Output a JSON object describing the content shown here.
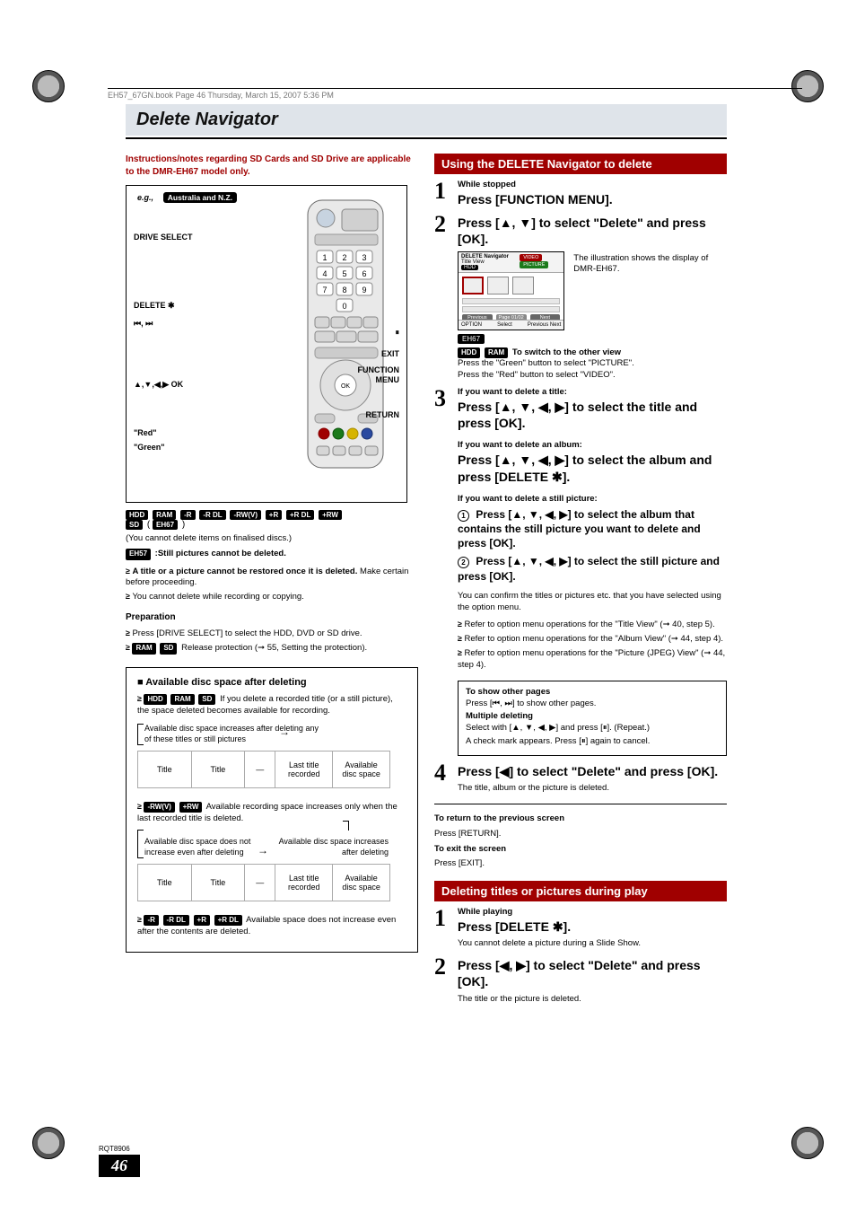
{
  "top_rule_text": "EH57_67GN.book  Page 46  Thursday, March 15, 2007  5:36 PM",
  "page_title": "Delete Navigator",
  "sd_note": "Instructions/notes regarding SD Cards and SD Drive are applicable to the DMR-EH67 model only.",
  "remote": {
    "eg_prefix": "e.g.,",
    "eg_chip": "Australia and N.Z.",
    "labels": {
      "drive_select": "DRIVE SELECT",
      "delete": "DELETE ✱",
      "skip": "⏮, ⏭",
      "arrows_ok": "▲,▼,◀,▶ OK",
      "red": "\"Red\"",
      "green": "\"Green\"",
      "pause": "⏸",
      "exit": "EXIT",
      "function_menu": "FUNCTION MENU",
      "return": "RETURN"
    }
  },
  "media_chips_row1": [
    "HDD",
    "RAM",
    "-R",
    "-R DL",
    "-RW(V)",
    "+R",
    "+R DL",
    "+RW"
  ],
  "media_chips_row2_sd": "SD",
  "media_chips_row2_paren_open": "(",
  "media_chips_row2_eh": "EH67",
  "media_chips_row2_paren_close": ")",
  "finalised_note": "(You cannot delete items on finalised discs.)",
  "eh57_chip": "EH57",
  "eh57_note": ":Still pictures cannot be deleted.",
  "warn1_bold": "A title or a picture cannot be restored once it is deleted.",
  "warn1_rest": " Make certain before proceeding.",
  "warn2": "You cannot delete while recording or copying.",
  "preparation_title": "Preparation",
  "prep_b1": "Press [DRIVE SELECT] to select the HDD, DVD or SD drive.",
  "prep_b2_chips": [
    "RAM",
    "SD"
  ],
  "prep_b2_text": " Release protection (➞ 55, Setting the protection).",
  "disc_box": {
    "heading": "Available disc space after deleting",
    "line1_chips": [
      "HDD",
      "RAM",
      "SD"
    ],
    "line1_text": " If you delete a recorded title (or a still picture), the space deleted becomes available for recording.",
    "header_a": "Available disc space increases after deleting any of these titles or still pictures",
    "cells": {
      "title": "Title",
      "dash": "—",
      "last": "Last title recorded",
      "avail": "Available disc space"
    },
    "mid_chips": [
      "-RW(V)",
      "+RW"
    ],
    "mid_text": " Available recording space increases only when the last recorded title is deleted.",
    "header_b_left": "Available disc space does not increase even after deleting",
    "header_b_right": "Available disc space increases after deleting",
    "last_chips": [
      "-R",
      "-R DL",
      "+R",
      "+R DL"
    ],
    "last_text": " Available space does not increase even after the contents are deleted."
  },
  "right": {
    "bar1": "Using the DELETE Navigator to delete",
    "step1": {
      "sub": "While stopped",
      "main": "Press [FUNCTION MENU]."
    },
    "step2": {
      "main": "Press [▲, ▼] to select \"Delete\" and press [OK]."
    },
    "screen": {
      "title_left": "DELETE Navigator",
      "title_right": "Title View",
      "hdd": "HDD",
      "video_btn": "VIDEO",
      "picture_btn": "PICTURE",
      "nav_prev": "Previous",
      "nav_page": "Page 01/02",
      "nav_next": "Next",
      "foot_option": "OPTION",
      "foot_select": "Select",
      "foot_prev": "Previous",
      "foot_next": "Next"
    },
    "illus_text": "The illustration shows the display of DMR-EH67.",
    "eh67_chip": "EH67",
    "switch_chips": [
      "HDD",
      "RAM"
    ],
    "switch_bold": "To switch to the other view",
    "switch_l1": "Press the \"Green\" button to select \"PICTURE\".",
    "switch_l2": "Press the \"Red\" button to select \"VIDEO\".",
    "step3": {
      "sub": "If you want to delete a title:",
      "main": "Press [▲, ▼, ◀, ▶] to select the title and press [OK].",
      "sub2": "If you want to delete an album:",
      "main2": "Press [▲, ▼, ◀, ▶] to select the album and press [DELETE ✱].",
      "sub3": "If you want to delete a still picture:",
      "c1": "Press [▲, ▼, ◀, ▶] to select the album that contains the still picture you want to delete and press [OK].",
      "c2": "Press [▲, ▼, ◀, ▶] to select the still picture and press [OK].",
      "confirm": "You can confirm the titles or pictures etc. that you have selected using the option menu.",
      "r1": "Refer to option menu operations for the \"Title View\" (➞ 40, step 5).",
      "r2": "Refer to option menu operations for the \"Album View\" (➞ 44, step 4).",
      "r3": "Refer to option menu operations for the \"Picture (JPEG) View\" (➞ 44, step 4)."
    },
    "tip": {
      "t1": "To show other pages",
      "p1": "Press [⏮, ⏭] to show other pages.",
      "t2": "Multiple deleting",
      "p2": "Select with [▲, ▼, ◀, ▶] and press [⏸]. (Repeat.)",
      "p3": "A check mark appears. Press [⏸] again to cancel."
    },
    "step4": {
      "main": "Press [◀] to select \"Delete\" and press [OK].",
      "after": "The title, album or the picture is deleted."
    },
    "ret_title": "To return to the previous screen",
    "ret_text": "Press [RETURN].",
    "exit_title": "To exit the screen",
    "exit_text": "Press [EXIT].",
    "bar2": "Deleting titles or pictures during play",
    "play_step1": {
      "sub": "While playing",
      "main": "Press [DELETE ✱].",
      "after": "You cannot delete a picture during a Slide Show."
    },
    "play_step2": {
      "main": "Press [◀, ▶] to select \"Delete\" and press [OK].",
      "after": "The title or the picture is deleted."
    }
  },
  "footer": {
    "rqt": "RQT8906",
    "pg": "46"
  }
}
